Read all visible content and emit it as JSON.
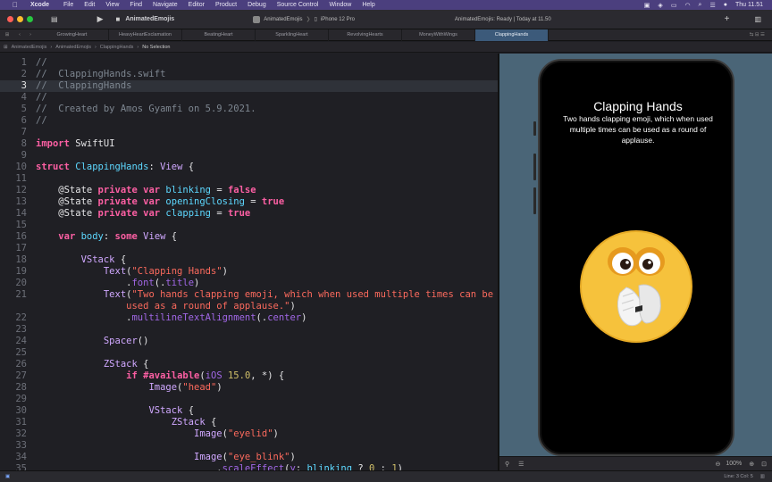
{
  "menubar": {
    "items": [
      "Xcode",
      "File",
      "Edit",
      "View",
      "Find",
      "Navigate",
      "Editor",
      "Product",
      "Debug",
      "Source Control",
      "Window",
      "Help"
    ],
    "clock": "Thu 11.51"
  },
  "toolbar": {
    "project": "AnimatedEmojis",
    "scheme": "AnimatedEmojis",
    "device": "iPhone 12 Pro",
    "status": "AnimatedEmojis: Ready | Today at 11.50"
  },
  "tabs": [
    "GrowingHeart",
    "HeavyHeartExclamation",
    "BeatingHeart",
    "SparklingHeart",
    "RevolvingHearts",
    "MoneyWithWings",
    "ClappingHands"
  ],
  "jumpbar": [
    "AnimatedEmojis",
    "AnimatedEmojis",
    "ClappingHands",
    "No Selection"
  ],
  "editor": {
    "current_line": 3,
    "lines": [
      {
        "n": "1",
        "t": [
          [
            "//",
            "com"
          ]
        ]
      },
      {
        "n": "2",
        "t": [
          [
            "//  ClappingHands.swift",
            "com"
          ]
        ]
      },
      {
        "n": "3",
        "t": [
          [
            "//  ClappingHands",
            "com"
          ]
        ]
      },
      {
        "n": "4",
        "t": [
          [
            "//",
            "com"
          ]
        ]
      },
      {
        "n": "5",
        "t": [
          [
            "//  Created by Amos Gyamfi on 5.9.2021.",
            "com"
          ]
        ]
      },
      {
        "n": "6",
        "t": [
          [
            "//",
            "com"
          ]
        ]
      },
      {
        "n": "7",
        "t": []
      },
      {
        "n": "8",
        "t": [
          [
            "import",
            "kw"
          ],
          [
            " SwiftUI",
            ""
          ]
        ]
      },
      {
        "n": "9",
        "t": []
      },
      {
        "n": "10",
        "t": [
          [
            "struct",
            "kw"
          ],
          [
            " ",
            ""
          ],
          [
            "ClappingHands",
            "dec"
          ],
          [
            ": ",
            ""
          ],
          [
            "View",
            "typ"
          ],
          [
            " {",
            ""
          ]
        ]
      },
      {
        "n": "11",
        "t": []
      },
      {
        "n": "12",
        "t": [
          [
            "    @State ",
            ""
          ],
          [
            "private var",
            "kw"
          ],
          [
            " ",
            ""
          ],
          [
            "blinking",
            "dec"
          ],
          [
            " = ",
            ""
          ],
          [
            "false",
            "kw"
          ]
        ]
      },
      {
        "n": "13",
        "t": [
          [
            "    @State ",
            ""
          ],
          [
            "private var",
            "kw"
          ],
          [
            " ",
            ""
          ],
          [
            "openingClosing",
            "dec"
          ],
          [
            " = ",
            ""
          ],
          [
            "true",
            "kw"
          ]
        ]
      },
      {
        "n": "14",
        "t": [
          [
            "    @State ",
            ""
          ],
          [
            "private var",
            "kw"
          ],
          [
            " ",
            ""
          ],
          [
            "clapping",
            "dec"
          ],
          [
            " = ",
            ""
          ],
          [
            "true",
            "kw"
          ]
        ]
      },
      {
        "n": "15",
        "t": []
      },
      {
        "n": "16",
        "t": [
          [
            "    ",
            ""
          ],
          [
            "var",
            "kw"
          ],
          [
            " ",
            ""
          ],
          [
            "body",
            "dec"
          ],
          [
            ": ",
            ""
          ],
          [
            "some",
            "kw"
          ],
          [
            " ",
            ""
          ],
          [
            "View",
            "typ"
          ],
          [
            " {",
            ""
          ]
        ]
      },
      {
        "n": "17",
        "t": []
      },
      {
        "n": "18",
        "t": [
          [
            "        ",
            ""
          ],
          [
            "VStack",
            "typ"
          ],
          [
            " {",
            ""
          ]
        ]
      },
      {
        "n": "19",
        "t": [
          [
            "            ",
            ""
          ],
          [
            "Text",
            "typ"
          ],
          [
            "(",
            ""
          ],
          [
            "\"Clapping Hands\"",
            "str"
          ],
          [
            ")",
            ""
          ]
        ]
      },
      {
        "n": "20",
        "t": [
          [
            "                .",
            ""
          ],
          [
            "font",
            "fn"
          ],
          [
            "(.",
            ""
          ],
          [
            "title",
            "fn"
          ],
          [
            ")",
            ""
          ]
        ]
      },
      {
        "n": "21",
        "t": [
          [
            "            ",
            ""
          ],
          [
            "Text",
            "typ"
          ],
          [
            "(",
            ""
          ],
          [
            "\"Two hands clapping emoji, which when used multiple times can be",
            "str"
          ]
        ]
      },
      {
        "n": "",
        "t": [
          [
            "                ",
            ""
          ],
          [
            "used as a round of applause.\"",
            "str"
          ],
          [
            ")",
            ""
          ]
        ]
      },
      {
        "n": "22",
        "t": [
          [
            "                .",
            ""
          ],
          [
            "multilineTextAlignment",
            "fn"
          ],
          [
            "(.",
            ""
          ],
          [
            "center",
            "fn"
          ],
          [
            ")",
            ""
          ]
        ]
      },
      {
        "n": "23",
        "t": []
      },
      {
        "n": "24",
        "t": [
          [
            "            ",
            ""
          ],
          [
            "Spacer",
            "typ"
          ],
          [
            "()",
            ""
          ]
        ]
      },
      {
        "n": "25",
        "t": []
      },
      {
        "n": "26",
        "t": [
          [
            "            ",
            ""
          ],
          [
            "ZStack",
            "typ"
          ],
          [
            " {",
            ""
          ]
        ]
      },
      {
        "n": "27",
        "t": [
          [
            "                ",
            ""
          ],
          [
            "if",
            "kw"
          ],
          [
            " ",
            ""
          ],
          [
            "#available",
            "kw"
          ],
          [
            "(",
            ""
          ],
          [
            "iOS",
            "fn"
          ],
          [
            " ",
            ""
          ],
          [
            "15.0",
            "num"
          ],
          [
            ", *) {",
            ""
          ]
        ]
      },
      {
        "n": "28",
        "t": [
          [
            "                    ",
            ""
          ],
          [
            "Image",
            "typ"
          ],
          [
            "(",
            ""
          ],
          [
            "\"head\"",
            "str"
          ],
          [
            ")",
            ""
          ]
        ]
      },
      {
        "n": "29",
        "t": []
      },
      {
        "n": "30",
        "t": [
          [
            "                    ",
            ""
          ],
          [
            "VStack",
            "typ"
          ],
          [
            " {",
            ""
          ]
        ]
      },
      {
        "n": "31",
        "t": [
          [
            "                        ",
            ""
          ],
          [
            "ZStack",
            "typ"
          ],
          [
            " {",
            ""
          ]
        ]
      },
      {
        "n": "32",
        "t": [
          [
            "                            ",
            ""
          ],
          [
            "Image",
            "typ"
          ],
          [
            "(",
            ""
          ],
          [
            "\"eyelid\"",
            "str"
          ],
          [
            ")",
            ""
          ]
        ]
      },
      {
        "n": "33",
        "t": []
      },
      {
        "n": "34",
        "t": [
          [
            "                            ",
            ""
          ],
          [
            "Image",
            "typ"
          ],
          [
            "(",
            ""
          ],
          [
            "\"eye_blink\"",
            "str"
          ],
          [
            ")",
            ""
          ]
        ]
      },
      {
        "n": "35",
        "t": [
          [
            "                                .",
            ""
          ],
          [
            "scaleEffect",
            "fn"
          ],
          [
            "(",
            ""
          ],
          [
            "y",
            "fn"
          ],
          [
            ": ",
            ""
          ],
          [
            "blinking",
            "dec"
          ],
          [
            " ? ",
            ""
          ],
          [
            "0",
            "num"
          ],
          [
            " : ",
            ""
          ],
          [
            "1",
            "num"
          ],
          [
            ")",
            ""
          ]
        ]
      }
    ]
  },
  "preview": {
    "title": "Clapping Hands",
    "subtitle": "Two hands clapping emoji, which when used multiple times can be used as a round of applause.",
    "zoom": "100%"
  },
  "statusbar": {
    "position": "Line: 3  Col: 5"
  }
}
